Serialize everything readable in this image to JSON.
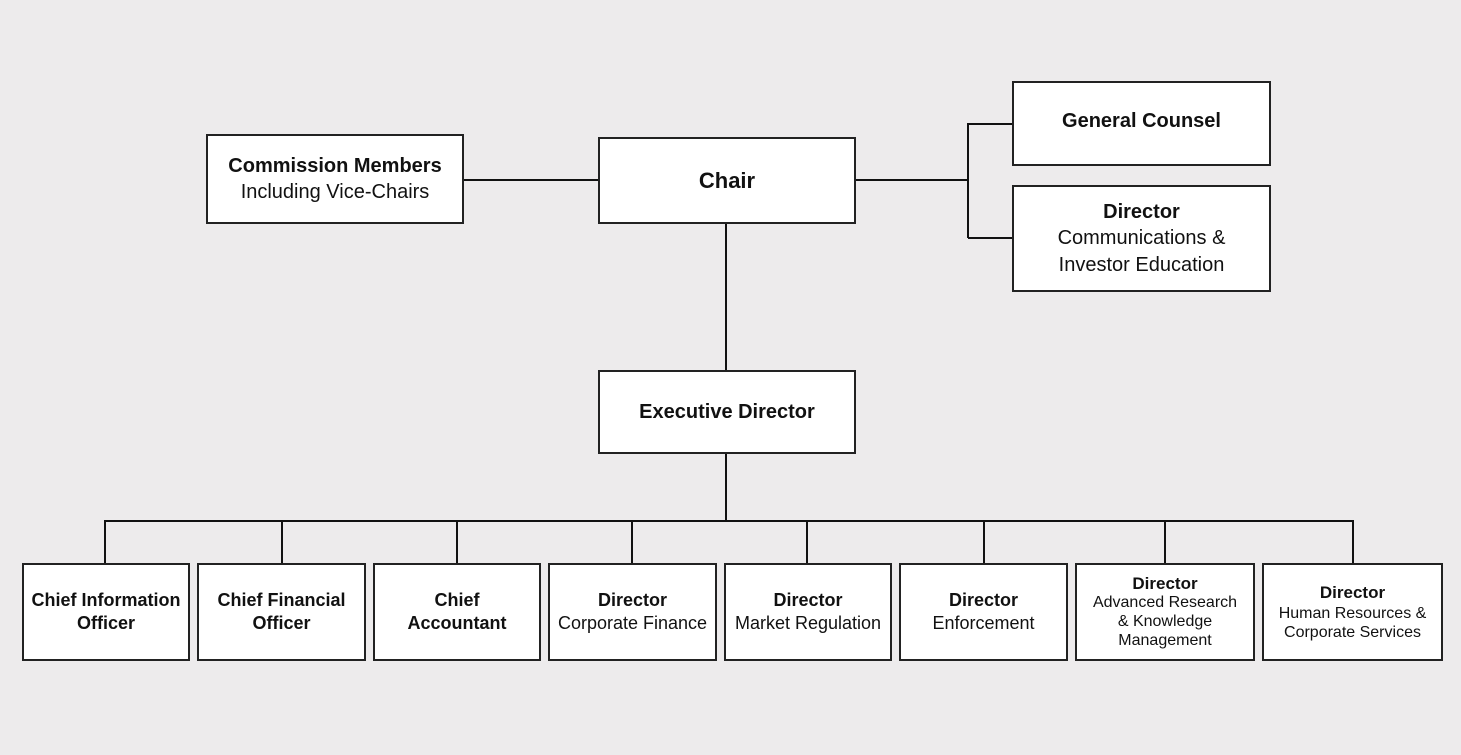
{
  "org_chart": {
    "chair": {
      "title": "Chair"
    },
    "commission_members": {
      "title": "Commission Members",
      "subtitle": "Including Vice-Chairs"
    },
    "general_counsel": {
      "title": "General Counsel"
    },
    "communications": {
      "title": "Director",
      "subtitle_lines": [
        "Communications &",
        "Investor Education"
      ]
    },
    "executive_director": {
      "title": "Executive Director"
    },
    "reports": [
      {
        "title_lines": [
          "Chief Information",
          "Officer"
        ]
      },
      {
        "title_lines": [
          "Chief Financial",
          "Officer"
        ]
      },
      {
        "title_lines": [
          "Chief",
          "Accountant"
        ]
      },
      {
        "title_lines": [
          "Director"
        ],
        "subtitle_lines": [
          "Corporate Finance"
        ]
      },
      {
        "title_lines": [
          "Director"
        ],
        "subtitle_lines": [
          "Market Regulation"
        ]
      },
      {
        "title_lines": [
          "Director"
        ],
        "subtitle_lines": [
          "Enforcement"
        ]
      },
      {
        "title_lines": [
          "Director"
        ],
        "subtitle_lines": [
          "Advanced Research",
          "& Knowledge",
          "Management"
        ]
      },
      {
        "title_lines": [
          "Director"
        ],
        "subtitle_lines": [
          "Human Resources &",
          "Corporate Services"
        ]
      }
    ]
  }
}
